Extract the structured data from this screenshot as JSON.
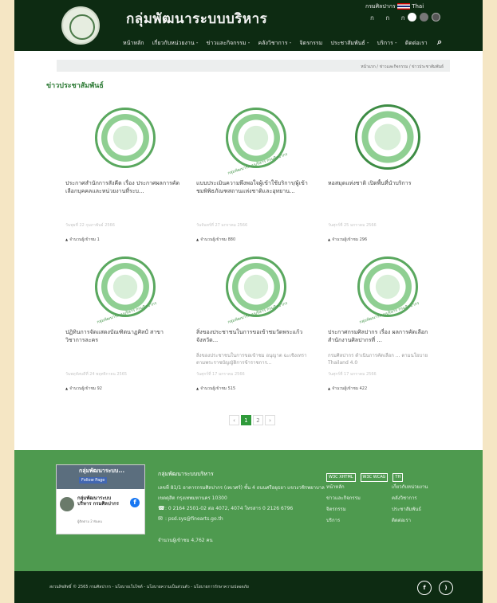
{
  "header": {
    "site_title": "กลุ่มพัฒนาระบบบริหาร",
    "topright_text": "กรมศิลปากร",
    "lang": "Thai",
    "font_sizes": "ก ก ก",
    "nav": [
      "หน้าหลัก",
      "เกี่ยวกับหน่วยงาน -",
      "ข่าวและกิจกรรม -",
      "คลังวิชาการ -",
      "จิตรกรรม",
      "ประชาสัมพันธ์ -",
      "บริการ -",
      "ติดต่อเรา"
    ]
  },
  "breadcrumb": "หน้าแรก / ข่าวและกิจกรรม / ข่าวประชาสัมพันธ์",
  "page_title": "ข่าวประชาสัมพันธ์",
  "cards": [
    {
      "title": "ประกาศสำนักการสังคีต เรื่อง ประกาศผลการคัดเลือกบุคคลและหน่วยงานที่ระบ...",
      "excerpt": "",
      "date": "วันพุธที่ 22 กุมภาพันธ์ 2566",
      "views": "จำนวนผู้เข้าชม 1",
      "seal": "small"
    },
    {
      "title": "แบบประเมินความพึงพอใจผู้เข้าใช้บริการ/ผู้เข้าชมพิพิธภัณฑสถานแห่งชาติและอุทยาน...",
      "excerpt": "",
      "date": "วันจันทร์ที่ 27 มกราคม 2566",
      "views": "จำนวนผู้เข้าชม 880",
      "seal": "small"
    },
    {
      "title": "หอสมุดแห่งชาติ เปิดพื้นที่นำบริการ",
      "excerpt": "",
      "date": "วันศุกร์ที่ 25 มกราคม 2566",
      "views": "จำนวนผู้เข้าชม 296",
      "seal": "big"
    },
    {
      "title": "ปฏิทินการจัดแสดงบัณฑิตนาฏศิลป์ สาขาวิชาการละคร",
      "excerpt": "",
      "date": "วันพฤหัสบดีที่ 24 พฤศจิกายน 2565",
      "views": "จำนวนผู้เข้าชม 92",
      "seal": "small"
    },
    {
      "title": "สิ่งของประชาชนในการขอเข้าชมวัดพระแก้ว จังหวัด...",
      "excerpt": "สิ่งของประชาชนในการขอเข้าชม อนุญาต ฉะเชิงเทรา ตามพระราชบัญญัติการข้าราชการ...",
      "date": "วันศุกร์ที่ 17 มกราคม 2566",
      "views": "จำนวนผู้เข้าชม 515",
      "seal": "small"
    },
    {
      "title": "ประกาศกรมศิลปากร เรื่อง ผลการคัดเลือก สำนักงานศิลปากรที่ ...",
      "excerpt": "กรมศิลปากร ดำเนินการคัดเลือก ... ตามนโยบาย Thailand 4.0",
      "date": "วันศุกร์ที่ 17 มกราคม 2566",
      "views": "จำนวนผู้เข้าชม 422",
      "seal": "small"
    }
  ],
  "seal_text": "กลุ่มพัฒนาระบบบริหาร กรมศิลปากร",
  "pager": {
    "prev": "‹",
    "pages": [
      "1",
      "2"
    ],
    "next": "›"
  },
  "footer": {
    "fb_name": "กลุ่มพัฒนาระบบ...",
    "fb_follow": "Follow Page",
    "fb_pname": "กลุ่มพัฒนาระบบบริหาร กรมศิลปากร",
    "fb_likes": "ผู้ติดตาม 2 พันคน",
    "org": "กลุ่มพัฒนาระบบบริหาร",
    "address": "เลขที่ 81/1 อาคารกรมศิลปากร (เทเวศร์) ชั้น 4 ถนนศรีอยุธยา แขวงวชิรพยาบาล เขตดุสิต กรุงเทพมหานคร 10300",
    "phone": ": 0 2164 2501-02 ต่อ 4072, 4074 โทรสาร 0 2126 6796",
    "email": ": psd.sys@finearts.go.th",
    "visitors": "จำนวนผู้เข้าชม 4,762 คน",
    "badges": [
      "W3C XHTML",
      "W3C WCAG",
      "TH"
    ],
    "links_left": [
      "หน้าหลัก",
      "ข่าวและกิจกรรม",
      "จิตรกรรม",
      "บริการ"
    ],
    "links_right": [
      "เกี่ยวกับหน่วยงาน",
      "คลังวิชาการ",
      "ประชาสัมพันธ์",
      "ติดต่อเรา"
    ]
  },
  "copyright": "สงวนลิขสิทธิ์ © 2565 กรมศิลปากร - นโยบายเว็บไซต์ - นโยบายความเป็นส่วนตัว - นโยบายการรักษาความปลอดภัย",
  "social": [
    "f",
    ")"
  ]
}
